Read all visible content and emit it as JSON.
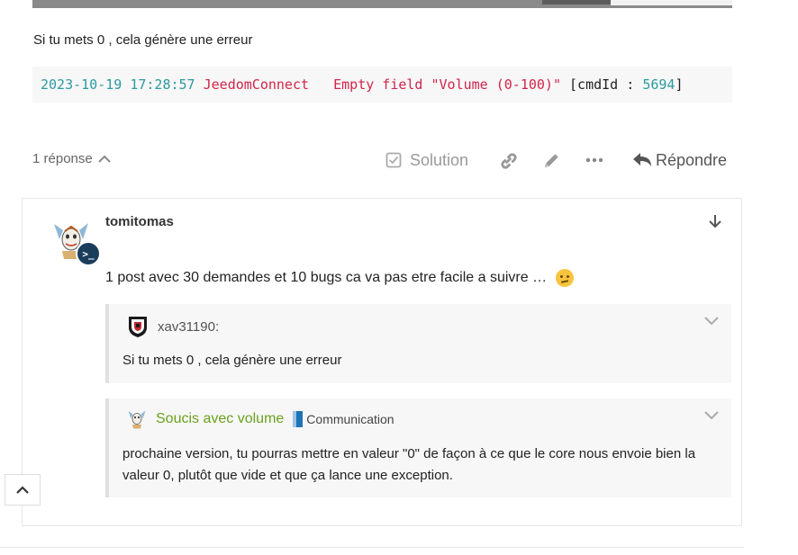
{
  "previous_post": {
    "text": "Si tu mets 0 , cela génère une erreur",
    "code": {
      "timestamp": "2023-10-19 17:28:57",
      "source": "JeedomConnect",
      "message": "Empty field \"Volume (0-100)\"",
      "cmd_open": "[cmdId :",
      "cmd_id": "5694",
      "cmd_close": "]"
    }
  },
  "post_actions": {
    "replies_label": "1 réponse",
    "solution_label": "Solution",
    "reply_label": "Répondre"
  },
  "reply_post": {
    "username": "tomitomas",
    "text": "1 post avec 30 demandes et 10 bugs ca va pas etre facile a suivre …",
    "quote1": {
      "author": "xav31190:",
      "text": "Si tu mets 0 , cela génère une erreur"
    },
    "quote2": {
      "topic": "Soucis avec volume",
      "category": "Communication",
      "text": "prochaine version, tu pourras mettre en valeur \"0\" de façon à ce que le core nous envoie bien la valeur 0, plutôt que vide et que ça lance une exception."
    }
  },
  "colors": {
    "link_green": "#6aa11f",
    "code_red": "#d1254a",
    "code_teal": "#2b9aa0",
    "category_blue": "#1e74b7"
  },
  "icons": [
    "checkbox-icon",
    "link-icon",
    "pencil-icon",
    "more-icon",
    "reply-icon",
    "arrow-down-icon",
    "chevron-down-icon",
    "chevron-up-icon",
    "terminal-badge-icon"
  ]
}
